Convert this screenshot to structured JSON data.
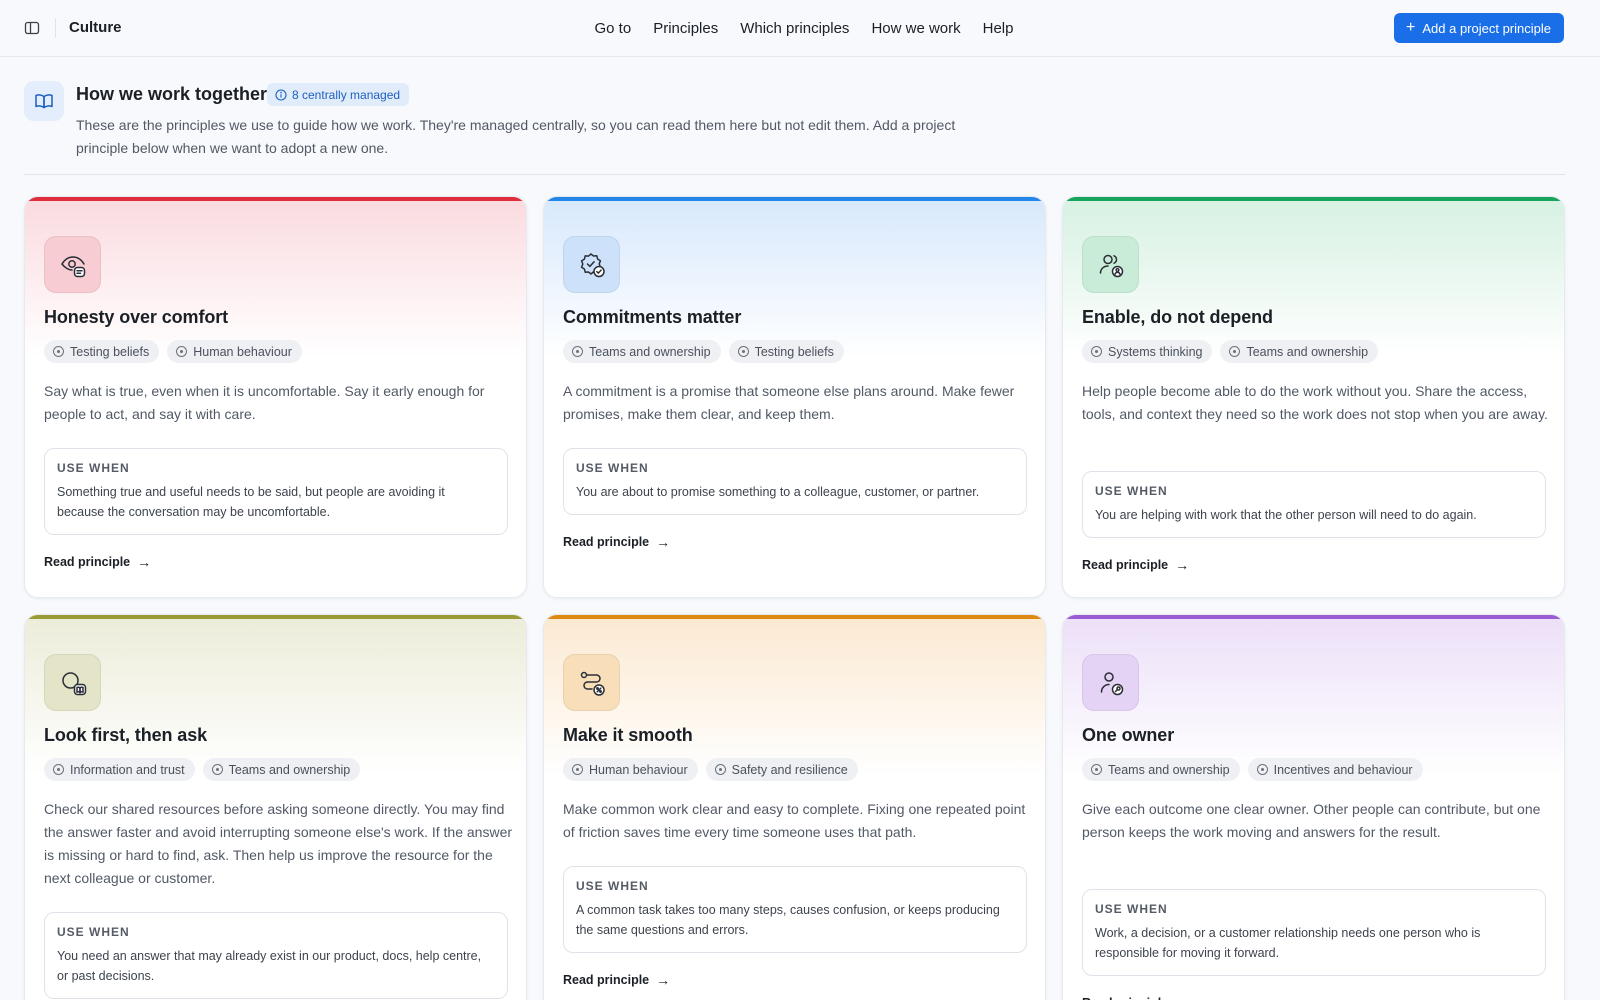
{
  "app": {
    "title": "Culture"
  },
  "topnav": [
    "Go to",
    "Principles",
    "Which principles",
    "How we work",
    "Help"
  ],
  "add_button": {
    "label": "Add a project principle",
    "color": "#1a6fe8"
  },
  "header": {
    "title": "How we work together",
    "badge": "8 centrally managed",
    "description": "These are the principles we use to guide how we work. They're managed centrally, so you can read them here but not edit them. Add a project principle below when we want to adopt a new one.",
    "icon": "book-open-icon"
  },
  "use_when_label": "USE WHEN",
  "read_label": "Read principle",
  "cards": [
    {
      "title": "Honesty over comfort",
      "accent": "#e02d3c",
      "wash": "#fadadf",
      "icon_bg": "#f7cdd3",
      "icon": "eye-message-icon",
      "chips": [
        "Testing beliefs",
        "Human behaviour"
      ],
      "description": "Say what is true, even when it is uncomfortable. Say it early enough for people to act, and say it with care.",
      "use_when": "Something true and useful needs to be said, but people are avoiding it because the conversation may be uncomfortable."
    },
    {
      "title": "Commitments matter",
      "accent": "#2385e8",
      "wash": "#d7e8fc",
      "icon_bg": "#cde2fa",
      "icon": "badge-check-icon",
      "chips": [
        "Teams and ownership",
        "Testing beliefs"
      ],
      "description": "A commitment is a promise that someone else plans around. Make fewer promises, make them clear, and keep them.",
      "use_when": "You are about to promise something to a colleague, customer, or partner."
    },
    {
      "title": "Enable, do not depend",
      "accent": "#16a35c",
      "wash": "#d6f1e2",
      "icon_bg": "#c9ecd8",
      "icon": "users-icon",
      "chips": [
        "Systems thinking",
        "Teams and ownership"
      ],
      "description": "Help people become able to do the work without you. Share the access, tools, and context they need so the work does not stop when you are away.",
      "use_when": "You are helping with work that the other person will need to do again."
    },
    {
      "title": "Look first, then ask",
      "accent": "#9a9a37",
      "wash": "#ececd9",
      "icon_bg": "#e4e4c9",
      "icon": "search-book-icon",
      "chips": [
        "Information and trust",
        "Teams and ownership"
      ],
      "description": "Check our shared resources before asking someone directly. You may find the answer faster and avoid interrupting someone else's work. If the answer is missing or hard to find, ask. Then help us improve the resource for the next colleague or customer.",
      "use_when": "You need an answer that may already exist in our product, docs, help centre, or past decisions."
    },
    {
      "title": "Make it smooth",
      "accent": "#dd8a12",
      "wash": "#fbe9d0",
      "icon_bg": "#f8dfba",
      "icon": "route-icon",
      "chips": [
        "Human behaviour",
        "Safety and resilience"
      ],
      "description": "Make common work clear and easy to complete. Fixing one repeated point of friction saves time every time someone uses that path.",
      "use_when": "A common task takes too many steps, causes confusion, or keeps producing the same questions and errors."
    },
    {
      "title": "One owner",
      "accent": "#9b5bd3",
      "wash": "#ecdff8",
      "icon_bg": "#e5d3f6",
      "icon": "user-key-icon",
      "chips": [
        "Teams and ownership",
        "Incentives and behaviour"
      ],
      "description": "Give each outcome one clear owner. Other people can contribute, but one person keeps the work moving and answers for the result.",
      "use_when": "Work, a decision, or a customer relationship needs one person who is responsible for moving it forward."
    }
  ]
}
